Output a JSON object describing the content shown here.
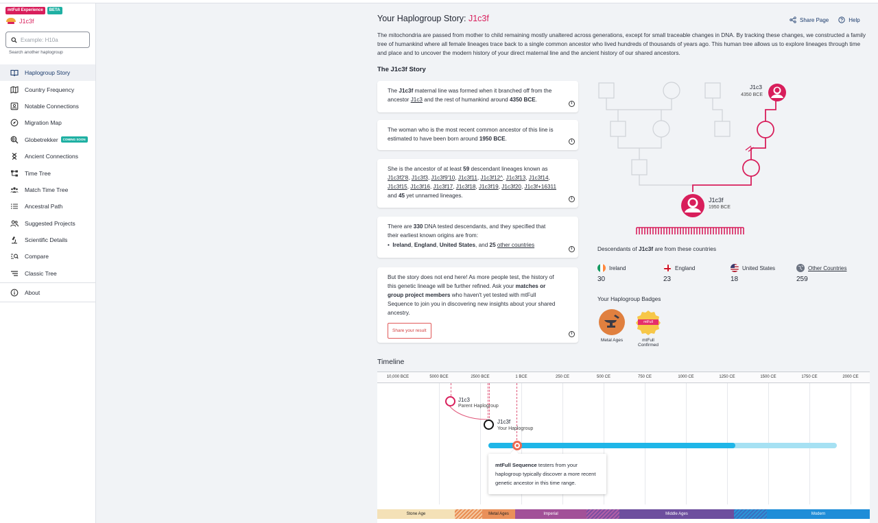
{
  "sidebar": {
    "badges": {
      "experience": "mtFull Experience",
      "beta": "BETA"
    },
    "current_haplogroup": "J1c3f",
    "search": {
      "placeholder": "Example: H10a",
      "hint": "Search another haplogroup"
    },
    "nav": [
      {
        "label": "Haplogroup Story",
        "icon": "book-open-icon",
        "active": true
      },
      {
        "label": "Country Frequency",
        "icon": "map-icon"
      },
      {
        "label": "Notable Connections",
        "icon": "contact-card-icon"
      },
      {
        "label": "Migration Map",
        "icon": "compass-icon"
      },
      {
        "label": "Globetrekker",
        "icon": "globe-search-icon",
        "badge": "COMING SOON"
      },
      {
        "label": "Ancient Connections",
        "icon": "dna-icon"
      },
      {
        "label": "Time Tree",
        "icon": "tree-icon"
      },
      {
        "label": "Match Time Tree",
        "icon": "group-icon"
      },
      {
        "label": "Ancestral Path",
        "icon": "list-icon"
      },
      {
        "label": "Suggested Projects",
        "icon": "people-icon"
      },
      {
        "label": "Scientific Details",
        "icon": "microscope-icon"
      },
      {
        "label": "Compare",
        "icon": "compare-icon"
      },
      {
        "label": "Classic Tree",
        "icon": "lines-icon"
      }
    ],
    "about": {
      "label": "About",
      "icon": "info-icon"
    }
  },
  "header": {
    "title_prefix": "Your Haplogroup Story: ",
    "haplogroup": "J1c3f",
    "share_label": "Share Page",
    "help_label": "Help"
  },
  "intro": "The mitochondria are passed from mother to child remaining mostly unaltered across generations, except for small traceable changes in DNA. By tracking these changes, we constructed a family tree of humankind where all female lineages trace back to a single common ancestor who lived hundreds of thousands of years ago. This human tree allows us to explore lineages through time and place and to uncover the modern history of your direct maternal line and the ancient history of our shared ancestors.",
  "story": {
    "heading": "The J1c3f Story",
    "card1": {
      "t1": "The ",
      "hap": "J1c3f",
      "t2": " maternal line was formed when it branched off from the ancestor ",
      "parent": "J1c3",
      "t3": " and the rest of humankind around ",
      "date": "4350 BCE",
      "t4": "."
    },
    "card2": {
      "t1": "The woman who is the most recent common ancestor of this line is estimated to have been born around ",
      "date": "1950 BCE",
      "t2": "."
    },
    "card3": {
      "t1": "She is the ancestor of at least ",
      "count": "59",
      "t2": " descendant lineages known as ",
      "lineages": [
        "J1c3f2'8",
        "J1c3f3",
        "J1c3f9'10",
        "J1c3f11",
        "J1c3f12^",
        "J1c3f13",
        "J1c3f14",
        "J1c3f15",
        "J1c3f16",
        "J1c3f17",
        "J1c3f18",
        "J1c3f19",
        "J1c3f20",
        "J1c3f+16311"
      ],
      "t3": " and ",
      "unnamed": "45",
      "t4": " yet unnamed lineages."
    },
    "card4": {
      "t1": "There are ",
      "count": "330",
      "t2": " DNA tested descendants, and they specified that their earliest known origins are from:",
      "c1": "Ireland",
      "c2": "England",
      "c3": "United States",
      "t3": ", and ",
      "other_count": "25",
      "other_link": "other countries"
    },
    "card5": {
      "t1": "But the story does not end here! As more people test, the history of this genetic lineage will be further refined. Ask your ",
      "b1": "matches or group project members",
      "t2": " who haven't yet tested with mtFull Sequence to join you in discovering new insights about your shared ancestry.",
      "button": "Share your result"
    }
  },
  "tree": {
    "top": {
      "name": "J1c3",
      "date": "4350 BCE"
    },
    "bottom": {
      "name": "J1c3f",
      "date": "1950 BCE"
    },
    "accent_color": "#d81e5b"
  },
  "countries": {
    "title_prefix": "Descendants of ",
    "title_hap": "J1c3f",
    "title_suffix": " are from these countries",
    "items": [
      {
        "name": "Ireland",
        "count": "30",
        "icon": "ireland-flag-icon"
      },
      {
        "name": "England",
        "count": "23",
        "icon": "england-flag-icon"
      },
      {
        "name": "United States",
        "count": "18",
        "icon": "us-flag-icon"
      },
      {
        "name": "Other Countries",
        "count": "259",
        "icon": "globe-icon"
      }
    ]
  },
  "badges": {
    "title": "Your Haplogroup Badges",
    "items": [
      {
        "label": "Metal Ages",
        "icon": "anvil-icon"
      },
      {
        "label": "mtFull Confirmed",
        "icon": "mtfull-confirmed-icon",
        "ribbon": "mtFull"
      }
    ]
  },
  "timeline": {
    "heading": "Timeline",
    "ticks": [
      "10,000 BCE",
      "5000 BCE",
      "2500 BCE",
      "1 BCE",
      "250 CE",
      "500 CE",
      "750 CE",
      "1000 CE",
      "1250 CE",
      "1500 CE",
      "1750 CE",
      "2000 CE"
    ],
    "parent": {
      "name": "J1c3",
      "role": "Parent Haplogroup"
    },
    "yours": {
      "name": "J1c3f",
      "role": "Your Haplogroup"
    },
    "tooltip": {
      "bold": "mtFull Sequence",
      "rest": " testers from your haplogroup typically discover a more recent genetic ancestor in this time range."
    },
    "eras": [
      {
        "label": "Stone Age",
        "color": "#f4e1b7"
      },
      {
        "label": "",
        "color": "hatch-orange"
      },
      {
        "label": "Metal Ages",
        "color": "#e9905a"
      },
      {
        "label": "Imperial",
        "color": "#a25198"
      },
      {
        "label": "",
        "color": "hatch-purple"
      },
      {
        "label": "Middle Ages",
        "color": "#6d4e9e"
      },
      {
        "label": "",
        "color": "hatch-blue"
      },
      {
        "label": "Modern",
        "color": "#1f8dd8"
      }
    ]
  }
}
